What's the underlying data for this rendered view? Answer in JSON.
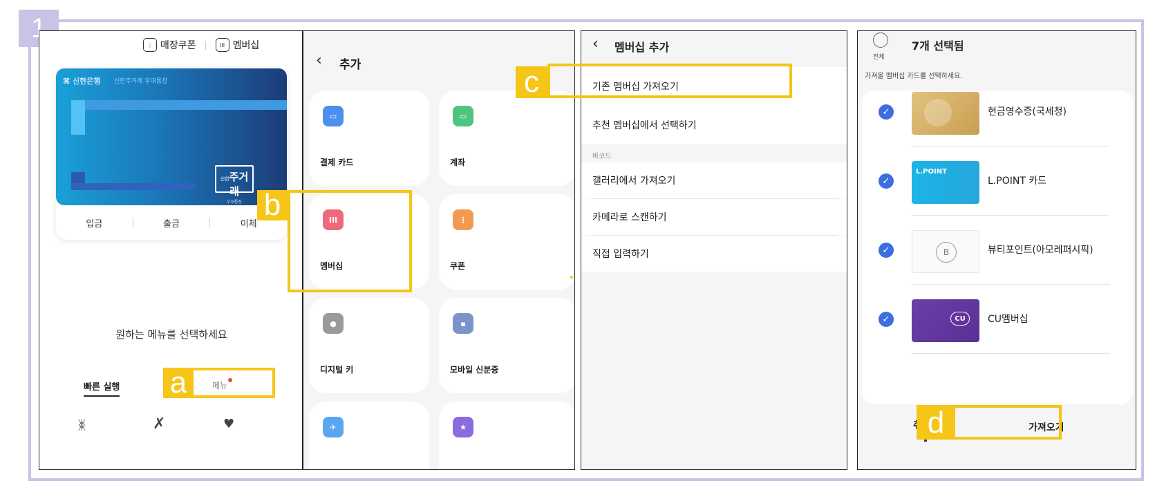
{
  "step_number": "1",
  "labels": {
    "a": "a",
    "b": "b",
    "c": "c",
    "d": "d"
  },
  "colors": {
    "highlight": "#f5c518",
    "frame": "#c9c3e6",
    "check": "#3b6fe0",
    "card_blue": "#1b76b8"
  },
  "screen1": {
    "store_coupon": "매장쿠폰",
    "membership": "멤버십",
    "card": {
      "bank": "신한은행",
      "account_name": "신한주거래 우대통장",
      "brand_small": "신한",
      "brand": "주거래",
      "brand_sub": "우대통장"
    },
    "actions": [
      "입금",
      "출금",
      "이체"
    ],
    "prompt": "원하는 메뉴를 선택하세요",
    "tabs": {
      "quick_run": "빠른 실행",
      "menu": "메뉴"
    },
    "bottom_icons": [
      "butterfly-icon",
      "ribbon-icon",
      "heart-icon"
    ]
  },
  "screen2": {
    "title": "추가",
    "tiles": [
      {
        "label": "결제 카드",
        "icon": "card-icon",
        "color": "#4d8ff0"
      },
      {
        "label": "계좌",
        "icon": "account-icon",
        "color": "#4fc47f"
      },
      {
        "label": "멤버십",
        "icon": "membership-icon",
        "color": "#ee6a7b"
      },
      {
        "label": "쿠폰",
        "icon": "coupon-icon",
        "color": "#f29b50"
      },
      {
        "label": "디지털 키",
        "icon": "key-icon",
        "color": "#9a9a9a"
      },
      {
        "label": "모바일 신분증",
        "icon": "id-icon",
        "color": "#7b95c9"
      },
      {
        "label": "",
        "icon": "plane-icon",
        "color": "#59a7f0"
      },
      {
        "label": "",
        "icon": "star-icon",
        "color": "#8a6be0"
      }
    ]
  },
  "screen3": {
    "title": "멤버십 추가",
    "items": [
      "기존 멤버십 가져오기",
      "추천 멤버십에서 선택하기"
    ],
    "section": "바코드",
    "barcode_items": [
      "갤러리에서 가져오기",
      "카메라로 스캔하기",
      "직접 입력하기"
    ]
  },
  "screen4": {
    "all_label": "전체",
    "selected_count": "7개 선택됨",
    "instruction": "가져올 멤버십 카드를 선택하세요.",
    "cards": [
      {
        "name": "현금영수증(국세청)"
      },
      {
        "name": "L.POINT 카드",
        "thumb_text": "L.POINT"
      },
      {
        "name": "뷰티포인트(아모레퍼시픽)"
      },
      {
        "name": "CU멤버십",
        "thumb_text": "CU"
      }
    ],
    "cancel": "취소",
    "import": "가져오기"
  }
}
